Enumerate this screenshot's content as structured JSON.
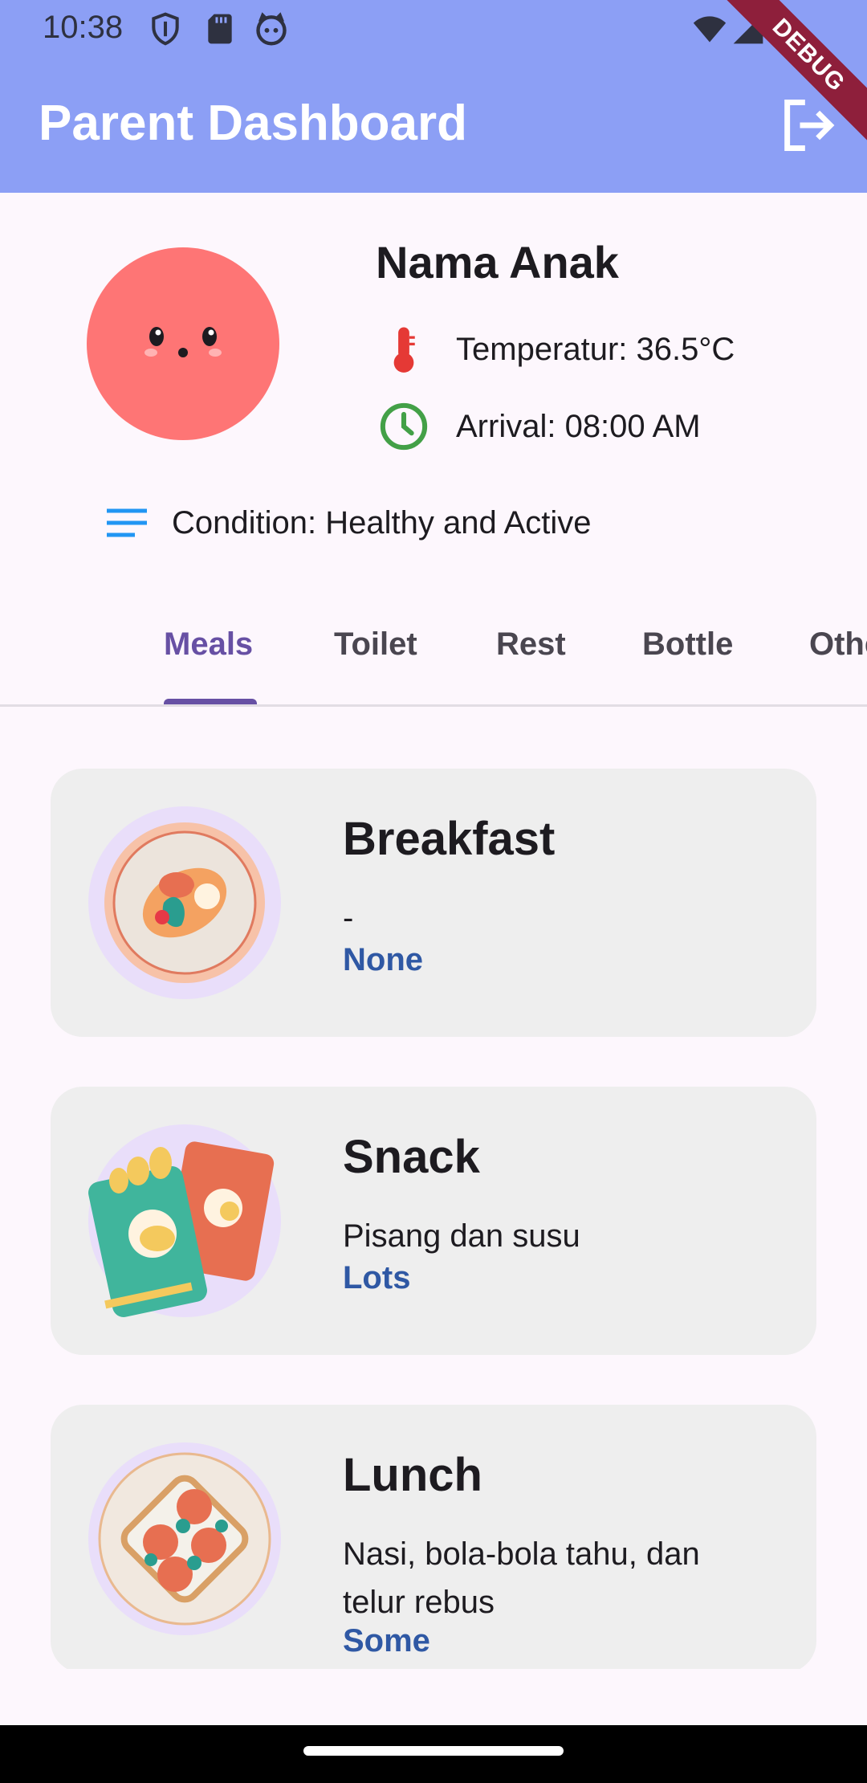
{
  "status_bar": {
    "time": "10:38",
    "icons": [
      "shield-icon",
      "sd-card-icon",
      "cat-face-icon",
      "wifi-icon",
      "signal-icon",
      "battery-icon"
    ]
  },
  "app_bar": {
    "title": "Parent Dashboard",
    "logout_icon": "logout-icon",
    "background": "#8c9ff5",
    "debug_label": "DEBUG"
  },
  "profile": {
    "name": "Nama Anak",
    "avatar_color": "#fe7575",
    "temperature": "Temperatur: 36.5°C",
    "arrival": "Arrival: 08:00 AM",
    "condition": "Condition: Healthy and Active"
  },
  "tabs": {
    "items": [
      "Meals",
      "Toilet",
      "Rest",
      "Bottle",
      "Others"
    ],
    "active": "Meals",
    "accent": "#6750a4"
  },
  "meals": [
    {
      "title": "Breakfast",
      "description": "-",
      "amount": "None"
    },
    {
      "title": "Snack",
      "description": "Pisang dan susu",
      "amount": "Lots"
    },
    {
      "title": "Lunch",
      "description": "Nasi, bola-bola tahu, dan telur rebus",
      "amount": "Some"
    }
  ],
  "colors": {
    "amount_text": "#2f58a4",
    "card_background": "#eeeeee"
  }
}
